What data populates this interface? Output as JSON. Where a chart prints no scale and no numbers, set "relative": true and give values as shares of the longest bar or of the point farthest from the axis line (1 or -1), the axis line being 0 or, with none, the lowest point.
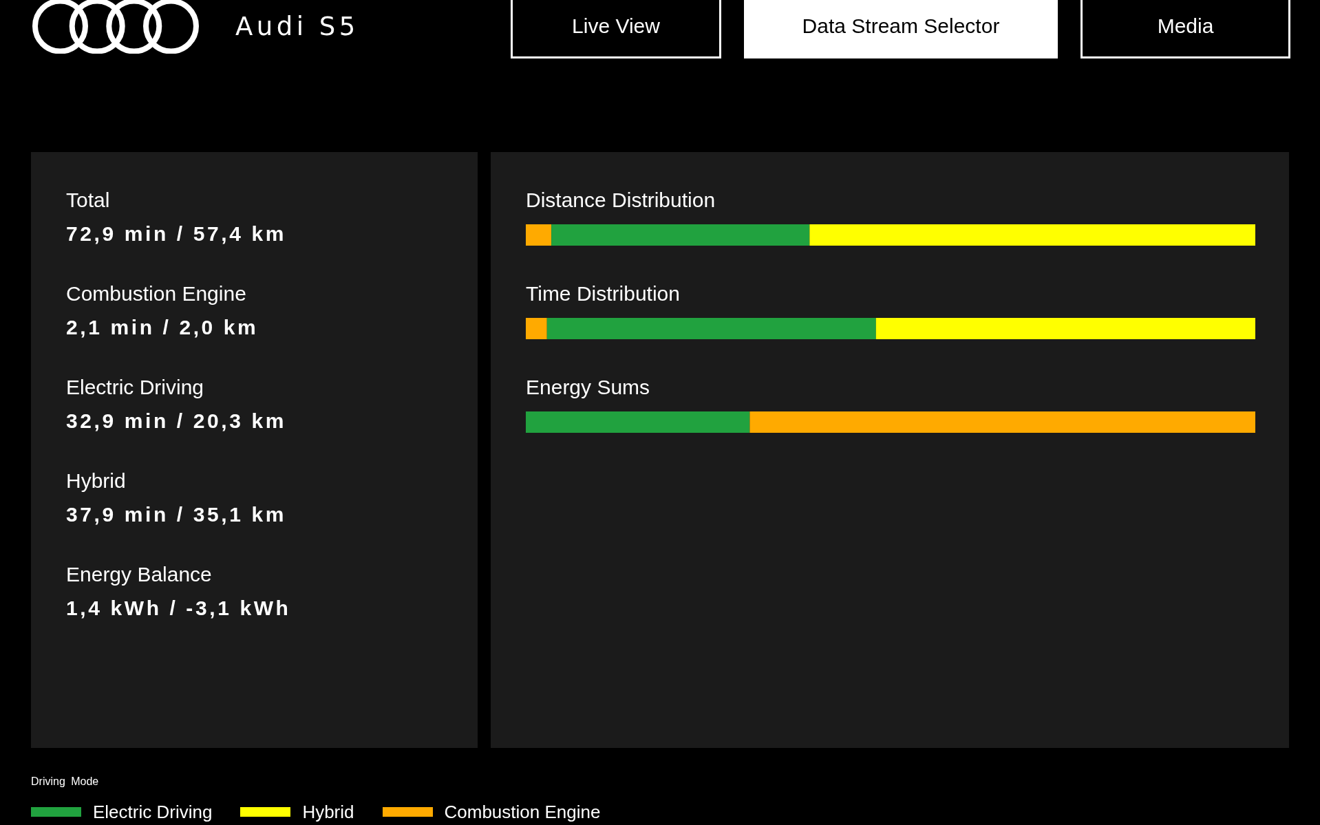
{
  "header": {
    "title": "Audi S5"
  },
  "tabs": [
    {
      "label": "Live View",
      "selected": false
    },
    {
      "label": "Data Stream Selector",
      "selected": true
    },
    {
      "label": "Media",
      "selected": false
    }
  ],
  "summary": [
    {
      "label": "Total",
      "value": "72,9 min / 57,4 km"
    },
    {
      "label": "Combustion Engine",
      "value": "2,1 min / 2,0 km"
    },
    {
      "label": "Electric Driving",
      "value": "32,9 min / 20,3 km"
    },
    {
      "label": "Hybrid",
      "value": "37,9 min / 35,1 km"
    },
    {
      "label": "Energy Balance",
      "value": "1,4 kWh / -3,1 kWh"
    }
  ],
  "distributions": [
    {
      "chart_data": {
        "type": "bar",
        "title": "Distance Distribution",
        "orientation": "horizontal",
        "stacked": true,
        "relative": true,
        "categories": [
          null
        ],
        "series": [
          {
            "color": "#ffaa00",
            "values": [
              0.035
            ]
          },
          {
            "color": "#21a23f",
            "values": [
              0.354
            ]
          },
          {
            "color": "#ffff00",
            "values": [
              0.611
            ]
          }
        ]
      }
    },
    {
      "chart_data": {
        "type": "bar",
        "title": "Time Distribution",
        "orientation": "horizontal",
        "stacked": true,
        "relative": true,
        "categories": [
          null
        ],
        "series": [
          {
            "color": "#ffaa00",
            "values": [
              0.029
            ]
          },
          {
            "color": "#21a23f",
            "values": [
              0.451
            ]
          },
          {
            "color": "#ffff00",
            "values": [
              0.52
            ]
          }
        ]
      }
    },
    {
      "chart_data": {
        "type": "bar",
        "title": "Energy Sums",
        "orientation": "horizontal",
        "stacked": true,
        "relative": true,
        "categories": [
          null
        ],
        "series": [
          {
            "color": "#21a23f",
            "values": [
              0.307
            ]
          },
          {
            "color": "#ffaa00",
            "values": [
              0.693
            ]
          }
        ]
      }
    }
  ],
  "legend": {
    "title": "Driving Mode",
    "items": [
      {
        "label": "Electric Driving",
        "color": "#21a23f"
      },
      {
        "label": "Hybrid",
        "color": "#ffff00"
      },
      {
        "label": "Combustion Engine",
        "color": "#ffaa00"
      }
    ]
  }
}
